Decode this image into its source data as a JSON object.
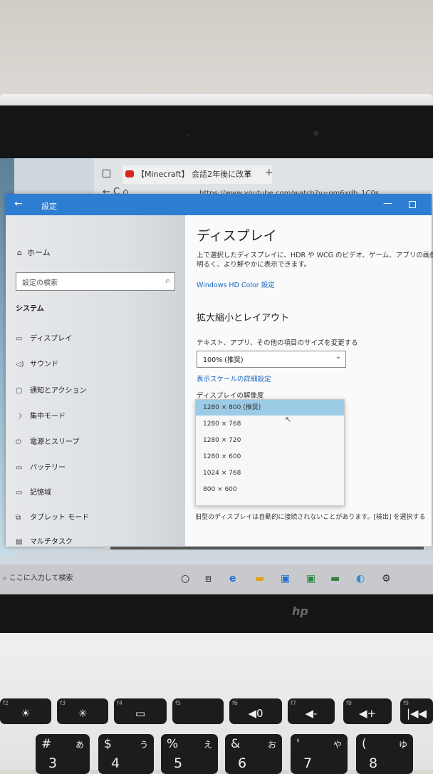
{
  "browser": {
    "tab_title": "【Minecraft】 会話2年後に改革",
    "tab_close": "×",
    "new_tab": "+",
    "nav": "←  C  ⌂",
    "url": "https://www.youtube.com/watch?v=om6xdb_1C0s"
  },
  "settings": {
    "window_title": "設定",
    "back": "←",
    "minimize": "—",
    "sidebar": {
      "home": "ホーム",
      "search_placeholder": "設定の検索",
      "section": "システム",
      "items": [
        {
          "icon": "display-icon",
          "glyph": "▭",
          "label": "ディスプレイ"
        },
        {
          "icon": "sound-icon",
          "glyph": "◁)",
          "label": "サウンド"
        },
        {
          "icon": "notification-icon",
          "glyph": "▢",
          "label": "通知とアクション"
        },
        {
          "icon": "focus-icon",
          "glyph": "☽",
          "label": "集中モード"
        },
        {
          "icon": "power-icon",
          "glyph": "⏻",
          "label": "電源とスリープ"
        },
        {
          "icon": "battery-icon",
          "glyph": "▭",
          "label": "バッテリー"
        },
        {
          "icon": "storage-icon",
          "glyph": "▭",
          "label": "記憶域"
        },
        {
          "icon": "tablet-icon",
          "glyph": "⧉",
          "label": "タブレット モード"
        },
        {
          "icon": "multitask-icon",
          "glyph": "▤",
          "label": "マルチタスク"
        }
      ]
    },
    "main": {
      "title": "ディスプレイ",
      "desc_line1": "上で選択したディスプレイに、HDR や WCG のビデオ、ゲーム、アプリの画像をより",
      "desc_line2": "明るく、より鮮やかに表示できます。",
      "hdr_link": "Windows HD Color 設定",
      "layout_heading": "拡大縮小とレイアウト",
      "scale_label": "テキスト、アプリ、その他の項目のサイズを変更する",
      "scale_value": "100% (推奨)",
      "advanced_link": "表示スケールの詳細設定",
      "resolution_label": "ディスプレイの解像度",
      "resolutions": [
        "1280 × 800 (推奨)",
        "1280 × 768",
        "1280 × 720",
        "1280 × 600",
        "1024 × 768",
        "800 × 600"
      ],
      "selected_index": 0,
      "footer": "旧型のディスプレイは自動的に接続されないことがあります。[検出] を選択する"
    }
  },
  "taskbar": {
    "search": "ここに入力して検索"
  },
  "brand": "hp",
  "keyboard": {
    "fkeys": [
      {
        "fn": "f2",
        "glyph": "☀"
      },
      {
        "fn": "f3",
        "glyph": "✳"
      },
      {
        "fn": "f4",
        "glyph": "▭"
      },
      {
        "fn": "f5",
        "glyph": ""
      },
      {
        "fn": "f6",
        "glyph": "◀0"
      },
      {
        "fn": "f7",
        "glyph": "◀-"
      },
      {
        "fn": "f8",
        "glyph": "◀+"
      },
      {
        "fn": "f9",
        "glyph": "|◀◀"
      }
    ],
    "numkeys": [
      {
        "top": "#",
        "bot": "3",
        "kana": "あ"
      },
      {
        "top": "$",
        "bot": "4",
        "kana": "う"
      },
      {
        "top": "%",
        "bot": "5",
        "kana": "え"
      },
      {
        "top": "&",
        "bot": "6",
        "kana": "お"
      },
      {
        "top": "'",
        "bot": "7",
        "kana": "や"
      },
      {
        "top": "(",
        "bot": "8",
        "kana": "ゆ"
      }
    ]
  },
  "colors": {
    "accent": "#2d7dd2",
    "link": "#1565c0",
    "selection": "#9ccbe6"
  }
}
